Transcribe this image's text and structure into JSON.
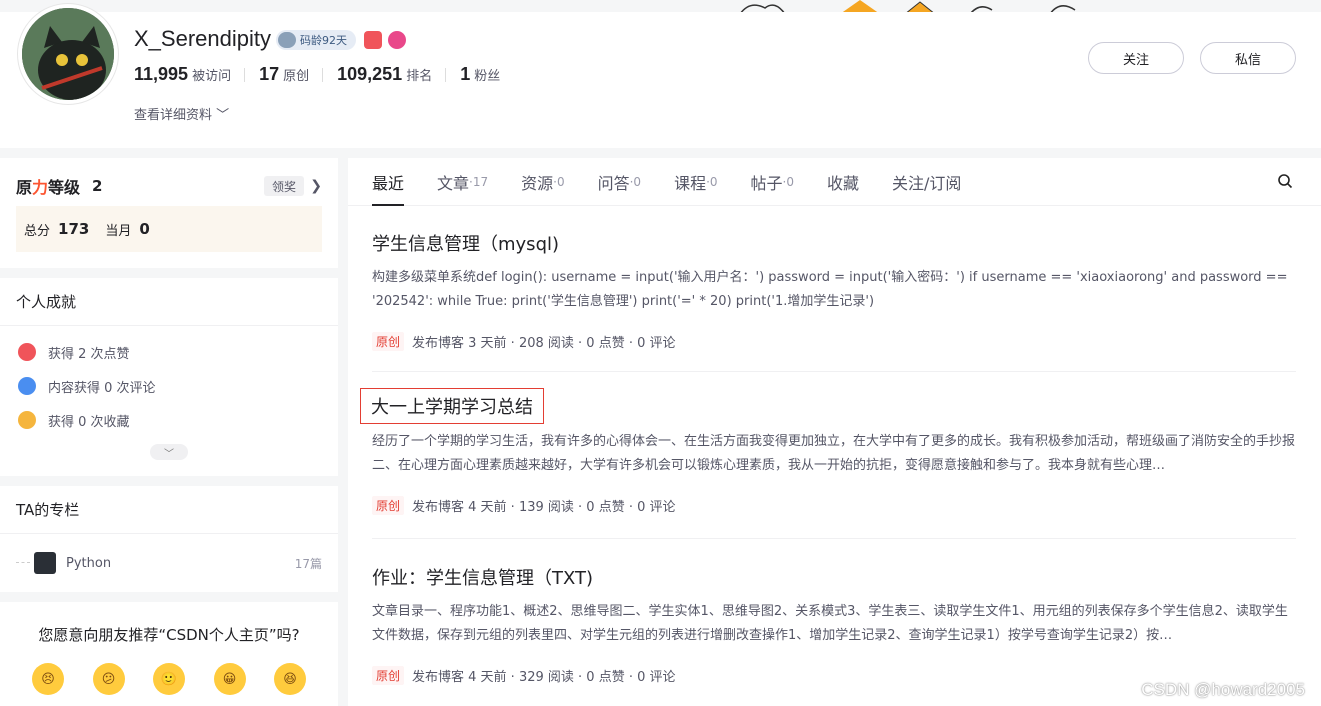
{
  "profile": {
    "username": "X_Serendipity",
    "code_age": "码龄92天",
    "stats": [
      {
        "num": "11,995",
        "label": "被访问"
      },
      {
        "num": "17",
        "label": "原创"
      },
      {
        "num": "109,251",
        "label": "排名"
      },
      {
        "num": "1",
        "label": "粉丝"
      }
    ],
    "detail_link": "查看详细资料",
    "follow_label": "关注",
    "message_label": "私信"
  },
  "level": {
    "title_prefix": "原",
    "title_highlight": "力",
    "title_suffix": "等级",
    "value": "2",
    "reward_label": "领奖",
    "total_label": "总分",
    "total_value": "173",
    "month_label": "当月",
    "month_value": "0"
  },
  "achievements": {
    "title": "个人成就",
    "items": [
      {
        "text": "获得 2 次点赞",
        "color": "#f0545a"
      },
      {
        "text": "内容获得 0 次评论",
        "color": "#4a8ef0"
      },
      {
        "text": "获得 0 次收藏",
        "color": "#f5b53d"
      }
    ]
  },
  "column": {
    "title": "TA的专栏",
    "name": "Python",
    "count": "17篇"
  },
  "recommend": {
    "question": "您愿意向朋友推荐“CSDN个人主页”吗?",
    "emojis": [
      "😣",
      "😕",
      "🙂",
      "😀",
      "😆"
    ]
  },
  "tabs": [
    {
      "label": "最近",
      "count": ""
    },
    {
      "label": "文章",
      "count": "·17"
    },
    {
      "label": "资源",
      "count": "·0"
    },
    {
      "label": "问答",
      "count": "·0"
    },
    {
      "label": "课程",
      "count": "·0"
    },
    {
      "label": "帖子",
      "count": "·0"
    },
    {
      "label": "收藏",
      "count": ""
    },
    {
      "label": "关注/订阅",
      "count": ""
    }
  ],
  "articles": [
    {
      "title": "学生信息管理（mysql)",
      "desc": "构建多级菜单系统def login(): username = input('输入用户名：') password = input('输入密码：') if username == 'xiaoxiaorong' and password == '202542': while True: print('学生信息管理') print('=' * 20) print('1.增加学生记录')",
      "tag": "原创",
      "meta": "发布博客 3 天前 · 208 阅读 · 0 点赞 · 0 评论"
    },
    {
      "title": "大一上学期学习总结",
      "desc": "经历了一个学期的学习生活，我有许多的心得体会一、在生活方面我变得更加独立，在大学中有了更多的成长。我有积极参加活动，帮班级画了消防安全的手抄报二、在心理方面心理素质越来越好，大学有许多机会可以锻炼心理素质，我从一开始的抗拒，变得愿意接触和参与了。我本身就有些心理…",
      "tag": "原创",
      "meta": "发布博客 4 天前 · 139 阅读 · 0 点赞 · 0 评论"
    },
    {
      "title": "作业：学生信息管理（TXT)",
      "desc": "文章目录一、程序功能1、概述2、思维导图二、学生实体1、思维导图2、关系模式3、学生表三、读取学生文件1、用元组的列表保存多个学生信息2、读取学生文件数据，保存到元组的列表里四、对学生元组的列表进行增删改查操作1、增加学生记录2、查询学生记录1）按学号查询学生记录2）按…",
      "tag": "原创",
      "meta": "发布博客 4 天前 · 329 阅读 · 0 点赞 · 0 评论"
    }
  ],
  "watermark": "CSDN @howard2005"
}
